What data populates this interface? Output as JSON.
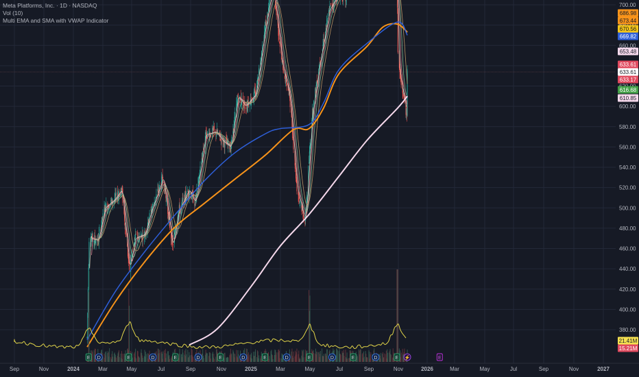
{
  "legend": {
    "title": "Meta Platforms, Inc. · 1D · NASDAQ",
    "volume": "Vol (10)",
    "indicator": "Multi EMA and SMA with VWAP Indicator"
  },
  "colors": {
    "background": "#161a25",
    "grid": "#232838",
    "axis_text": "#b2b5be",
    "ema_orange": "#f7931a",
    "sma_blue": "#2e5fd9",
    "sma_pink": "#f6d9ec",
    "volume_line": "#e5d84a",
    "up_candle": "#26a69a",
    "down_candle": "#ef5350"
  },
  "chart_data": {
    "type": "line",
    "y_axis": {
      "ticks": [
        "700.00",
        "680.00",
        "660.00",
        "640.00",
        "620.00",
        "600.00",
        "580.00",
        "560.00",
        "540.00",
        "520.00",
        "500.00",
        "480.00",
        "460.00",
        "440.00",
        "420.00",
        "400.00",
        "380.00"
      ],
      "range": [
        360,
        710
      ]
    },
    "x_axis": {
      "ticks": [
        "Sep",
        "Nov",
        "2024",
        "Mar",
        "May",
        "Jul",
        "Sep",
        "Nov",
        "2025",
        "Mar",
        "May",
        "Jul",
        "Sep",
        "Nov",
        "2026",
        "Mar",
        "May",
        "Jul",
        "Sep",
        "Nov",
        "2027"
      ]
    },
    "price_tags": [
      {
        "text": "686.98",
        "bg": "#f7931a",
        "fg": "#161a25"
      },
      {
        "text": "673.44",
        "bg": "#f7931a",
        "fg": "#161a25"
      },
      {
        "text": "670.56",
        "bg": "#f5c518",
        "fg": "#161a25"
      },
      {
        "text": "669.82",
        "bg": "#2e5fd9",
        "fg": "#ffffff"
      },
      {
        "text": "653.48",
        "bg": "#f6d9ec",
        "fg": "#161a25"
      },
      {
        "text": "633.61",
        "bg": "#e04a5f",
        "fg": "#ffffff"
      },
      {
        "text": "633.61",
        "bg": "#ffffff",
        "fg": "#161a25"
      },
      {
        "text": "633.17",
        "bg": "#e04a5f",
        "fg": "#ffffff"
      },
      {
        "text": "616.68",
        "bg": "#43a047",
        "fg": "#ffffff"
      },
      {
        "text": "610.85",
        "bg": "#f6d9ec",
        "fg": "#161a25"
      }
    ],
    "volume_tags": [
      {
        "text": "21.41M",
        "bg": "#f5e050",
        "fg": "#161a25"
      },
      {
        "text": "15.21M",
        "bg": "#e04a5f",
        "fg": "#ffffff"
      }
    ],
    "series": [
      {
        "key": "sma200",
        "color": "#f6d9ec",
        "width": 2,
        "x": [
          "2024-08-29",
          "2024-10-24",
          "2025-01-02",
          "2025-02-28",
          "2025-04-30",
          "2025-06-30",
          "2025-08-29",
          "2025-10-30",
          "2025-11-20"
        ],
        "values": [
          365,
          381,
          423,
          462,
          494,
          531,
          567,
          598,
          610
        ]
      },
      {
        "key": "ema100",
        "color": "#f7931a",
        "width": 2,
        "x": [
          "2024-01-29",
          "2024-03-28",
          "2024-05-30",
          "2024-07-30",
          "2024-09-27",
          "2024-11-28",
          "2025-01-30",
          "2025-03-28",
          "2025-04-29",
          "2025-05-29",
          "2025-06-30",
          "2025-08-28",
          "2025-09-30",
          "2025-10-30",
          "2025-11-20"
        ],
        "values": [
          363,
          408,
          448,
          481,
          504,
          528,
          552,
          577,
          578,
          598,
          632,
          659,
          678,
          681,
          673
        ]
      },
      {
        "key": "ema50",
        "color": "#2e5fd9",
        "width": 1.5,
        "x": [
          "2024-01-29",
          "2024-03-28",
          "2024-05-30",
          "2024-07-30",
          "2024-09-27",
          "2024-11-28",
          "2025-01-30",
          "2025-02-28",
          "2025-04-29",
          "2025-05-29",
          "2025-06-30",
          "2025-08-28",
          "2025-10-30",
          "2025-11-20"
        ],
        "values": [
          370,
          418,
          458,
          493,
          526,
          554,
          573,
          578,
          582,
          603,
          636,
          662,
          683,
          670
        ]
      }
    ],
    "volume": {
      "avg_line_color": "#e5d84a",
      "spike_dates": [
        "2024-02-02",
        "2024-04-26",
        "2025-04-30",
        "2025-10-30"
      ]
    },
    "events": [
      {
        "x": "2024-02-01",
        "kind": "earnings",
        "label": "E"
      },
      {
        "x": "2024-02-22",
        "kind": "dividend",
        "label": "D"
      },
      {
        "x": "2024-04-25",
        "kind": "earnings",
        "label": "E"
      },
      {
        "x": "2024-06-14",
        "kind": "dividend",
        "label": "D"
      },
      {
        "x": "2024-07-31",
        "kind": "earnings",
        "label": "E"
      },
      {
        "x": "2024-09-16",
        "kind": "dividend",
        "label": "D"
      },
      {
        "x": "2024-10-30",
        "kind": "earnings",
        "label": "E"
      },
      {
        "x": "2024-12-16",
        "kind": "dividend",
        "label": "D"
      },
      {
        "x": "2025-01-29",
        "kind": "earnings",
        "label": "E"
      },
      {
        "x": "2025-03-14",
        "kind": "dividend",
        "label": "D"
      },
      {
        "x": "2025-04-30",
        "kind": "earnings",
        "label": "E"
      },
      {
        "x": "2025-06-16",
        "kind": "dividend",
        "label": "D"
      },
      {
        "x": "2025-07-30",
        "kind": "earnings",
        "label": "E"
      },
      {
        "x": "2025-09-15",
        "kind": "dividend",
        "label": "D"
      },
      {
        "x": "2025-10-29",
        "kind": "earnings",
        "label": "E"
      },
      {
        "x": "2025-11-20",
        "kind": "split",
        "label": "⚡"
      },
      {
        "x": "2026-01-28",
        "kind": "earnings-future",
        "label": "E"
      }
    ]
  }
}
